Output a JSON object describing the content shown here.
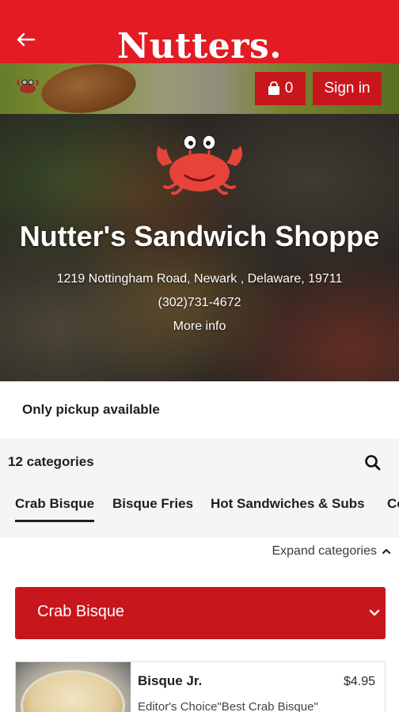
{
  "header": {
    "back_icon": "arrow-left-icon",
    "logo_text": "Nutters.",
    "cart_icon": "shopping-bag-icon",
    "cart_count": "0",
    "signin_label": "Sign in",
    "brand_color": "#e31b23"
  },
  "hero": {
    "logo_icon": "crab-mascot-icon",
    "shop_name": "Nutter's Sandwich Shoppe",
    "address": "1219 Nottingham Road, Newark , Delaware, 19711",
    "phone": "(302)731-4672",
    "more_info": "More info"
  },
  "pickup": {
    "text": "Only pickup available"
  },
  "categories": {
    "count_label": "12 categories",
    "search_icon": "search-icon",
    "tabs": [
      {
        "label": "Crab Bisque",
        "active": true
      },
      {
        "label": "Bisque Fries",
        "active": false
      },
      {
        "label": "Hot Sandwiches & Subs",
        "active": false
      },
      {
        "label": "Co",
        "active": false
      }
    ],
    "expand_label": "Expand categories",
    "expand_icon": "chevron-up-icon"
  },
  "section": {
    "title": "Crab Bisque",
    "chevron_icon": "chevron-down-icon",
    "color": "#c8161d"
  },
  "items": [
    {
      "name": "Bisque Jr.",
      "price": "$4.95",
      "description": "Editor's Choice\"Best Crab Bisque\""
    }
  ]
}
